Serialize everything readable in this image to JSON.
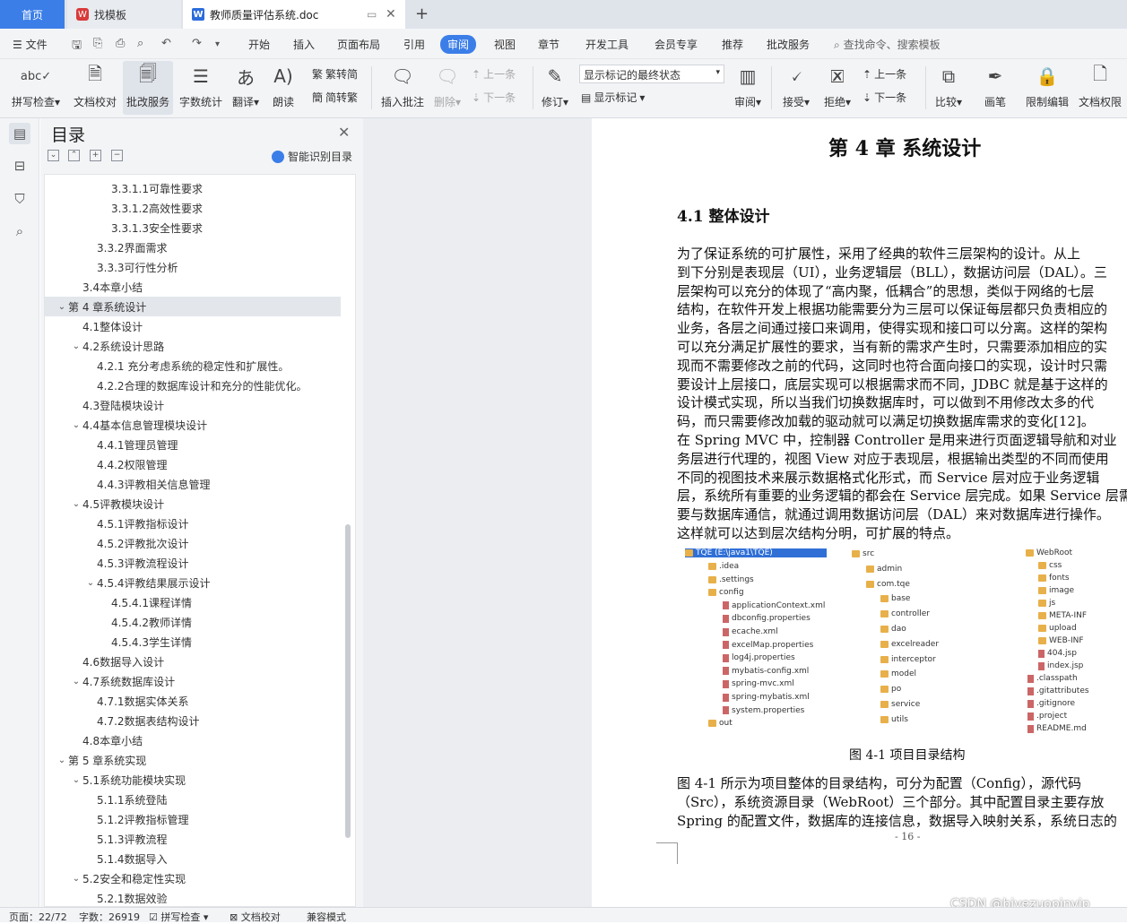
{
  "tabs": {
    "home": "首页",
    "templates": "找模板",
    "document": "教师质量评估系统.doc"
  },
  "menu": {
    "file": "文件",
    "items": [
      "开始",
      "插入",
      "页面布局",
      "引用",
      "审阅",
      "视图",
      "章节",
      "开发工具",
      "会员专享",
      "推荐",
      "批改服务"
    ],
    "search": "查找命令、搜索模板"
  },
  "ribbon": {
    "spellcheck": "拼写检查",
    "doc_proof": "文档校对",
    "correction_service": "批改服务",
    "word_count": "字数统计",
    "translate": "翻译",
    "read_aloud": "朗读",
    "trad_to_simp": "繁转简",
    "simp_to_trad": "简转繁",
    "insert_comment": "插入批注",
    "delete": "删除",
    "prev_comment": "上一条",
    "next_comment": "下一条",
    "track_changes": "修订",
    "markup_state": "显示标记的最终状态",
    "show_markup": "显示标记",
    "review": "审阅",
    "accept": "接受",
    "reject": "拒绝",
    "prev_change": "上一条",
    "next_change": "下一条",
    "compare": "比较",
    "pen": "画笔",
    "restrict_edit": "限制编辑",
    "doc_permission": "文档权限"
  },
  "toc": {
    "title": "目录",
    "smart_toc": "智能识别目录",
    "items": [
      {
        "text": "3.3.1.1可靠性要求",
        "level": 4,
        "chev": ""
      },
      {
        "text": "3.3.1.2高效性要求",
        "level": 4,
        "chev": ""
      },
      {
        "text": "3.3.1.3安全性要求",
        "level": 4,
        "chev": ""
      },
      {
        "text": "3.3.2界面需求",
        "level": 3,
        "chev": ""
      },
      {
        "text": "3.3.3可行性分析",
        "level": 3,
        "chev": ""
      },
      {
        "text": "3.4本章小结",
        "level": 2,
        "chev": ""
      },
      {
        "text": "第 4 章系统设计",
        "level": 1,
        "chev": "v",
        "selected": true
      },
      {
        "text": "4.1整体设计",
        "level": 2,
        "chev": ""
      },
      {
        "text": "4.2系统设计思路",
        "level": 2,
        "chev": "v"
      },
      {
        "text": "4.2.1  充分考虑系统的稳定性和扩展性。",
        "level": 3,
        "chev": ""
      },
      {
        "text": "4.2.2合理的数据库设计和充分的性能优化。",
        "level": 3,
        "chev": ""
      },
      {
        "text": "4.3登陆模块设计",
        "level": 2,
        "chev": ""
      },
      {
        "text": "4.4基本信息管理模块设计",
        "level": 2,
        "chev": "v"
      },
      {
        "text": "4.4.1管理员管理",
        "level": 3,
        "chev": ""
      },
      {
        "text": "4.4.2权限管理",
        "level": 3,
        "chev": ""
      },
      {
        "text": "4.4.3评教相关信息管理",
        "level": 3,
        "chev": ""
      },
      {
        "text": "4.5评教模块设计",
        "level": 2,
        "chev": "v"
      },
      {
        "text": "4.5.1评教指标设计",
        "level": 3,
        "chev": ""
      },
      {
        "text": "4.5.2评教批次设计",
        "level": 3,
        "chev": ""
      },
      {
        "text": "4.5.3评教流程设计",
        "level": 3,
        "chev": ""
      },
      {
        "text": "4.5.4评教结果展示设计",
        "level": 3,
        "chev": "v"
      },
      {
        "text": "4.5.4.1课程详情",
        "level": 4,
        "chev": ""
      },
      {
        "text": "4.5.4.2教师详情",
        "level": 4,
        "chev": ""
      },
      {
        "text": "4.5.4.3学生详情",
        "level": 4,
        "chev": ""
      },
      {
        "text": "4.6数据导入设计",
        "level": 2,
        "chev": ""
      },
      {
        "text": "4.7系统数据库设计",
        "level": 2,
        "chev": "v"
      },
      {
        "text": "4.7.1数据实体关系",
        "level": 3,
        "chev": ""
      },
      {
        "text": "4.7.2数据表结构设计",
        "level": 3,
        "chev": ""
      },
      {
        "text": "4.8本章小结",
        "level": 2,
        "chev": ""
      },
      {
        "text": "第 5 章系统实现",
        "level": 1,
        "chev": "v"
      },
      {
        "text": "5.1系统功能模块实现",
        "level": 2,
        "chev": "v"
      },
      {
        "text": "5.1.1系统登陆",
        "level": 3,
        "chev": ""
      },
      {
        "text": "5.1.2评教指标管理",
        "level": 3,
        "chev": ""
      },
      {
        "text": "5.1.3评教流程",
        "level": 3,
        "chev": ""
      },
      {
        "text": "5.1.4数据导入",
        "level": 3,
        "chev": ""
      },
      {
        "text": "5.2安全和稳定性实现",
        "level": 2,
        "chev": "v"
      },
      {
        "text": "5.2.1数据效验",
        "level": 3,
        "chev": ""
      }
    ]
  },
  "document": {
    "chapter_title": "第 4 章  系统设计",
    "section_title": "4.1  整体设计",
    "para1_lines": [
      "    为了保证系统的可扩展性，采用了经典的软件三层架构的设计。从上",
      "到下分别是表现层（UI），业务逻辑层（BLL），数据访问层（DAL）。三",
      "层架构可以充分的体现了“高内聚，低耦合”的思想，类似于网络的七层",
      "结构，在软件开发上根据功能需要分为三层可以保证每层都只负责相应的",
      "业务，各层之间通过接口来调用，使得实现和接口可以分离。这样的架构",
      "可以充分满足扩展性的要求，当有新的需求产生时，只需要添加相应的实",
      "现而不需要修改之前的代码，这同时也符合面向接口的实现，设计时只需",
      "要设计上层接口，底层实现可以根据需求而不同，JDBC 就是基于这样的",
      "设计模式实现，所以当我们切换数据库时，可以做到不用修改太多的代",
      "码，而只需要修改加载的驱动就可以满足切换数据库需求的变化[12]。"
    ],
    "para2_lines": [
      "    在 Spring MVC 中，控制器 Controller 是用来进行页面逻辑导航和对业",
      "务层进行代理的，视图 View 对应于表现层，根据输出类型的不同而使用",
      "不同的视图技术来展示数据格式化形式，而 Service 层对应于业务逻辑",
      "层，系统所有重要的业务逻辑的都会在 Service 层完成。如果 Service 层需",
      "要与数据库通信，就通过调用数据访问层（DAL）来对数据库进行操作。",
      "这样就可以达到层次结构分明，可扩展的特点。"
    ],
    "figure": {
      "col1_root": "TQE (E:\\java1\\TQE)",
      "col1": [
        ".idea",
        ".settings",
        "config",
        "applicationContext.xml",
        "dbconfig.properties",
        "ecache.xml",
        "excelMap.properties",
        "log4j.properties",
        "mybatis-config.xml",
        "spring-mvc.xml",
        "spring-mybatis.xml",
        "system.properties",
        "out"
      ],
      "col2": [
        "src",
        "admin",
        "com.tqe",
        "base",
        "controller",
        "dao",
        "excelreader",
        "interceptor",
        "model",
        "po",
        "service",
        "utils"
      ],
      "col3": [
        "WebRoot",
        "css",
        "fonts",
        "image",
        "js",
        "META-INF",
        "upload",
        "WEB-INF",
        "404.jsp",
        "index.jsp",
        ".classpath",
        ".gitattributes",
        ".gitignore",
        ".project",
        "README.md"
      ]
    },
    "fig_caption": "图 4-1 项目目录结构",
    "para3_lines": [
      "    图 4-1 所示为项目整体的目录结构，可分为配置（Config），源代码",
      "（Src），系统资源目录（WebRoot）三个部分。其中配置目录主要存放",
      "Spring 的配置文件，数据库的连接信息，数据导入映射关系，系统日志的"
    ],
    "page_number": "- 16 -"
  },
  "status": {
    "page": "页面：22/72",
    "words": "字数：26919",
    "spellcheck": "拼写检查",
    "doc_proof": "文档校对",
    "compat": "兼容模式"
  },
  "watermark": "CSDN @biyezuopinvip",
  "colors": {
    "accent": "#3b7ee8",
    "page": "#ffffff",
    "canvas": "#ebedf0"
  }
}
